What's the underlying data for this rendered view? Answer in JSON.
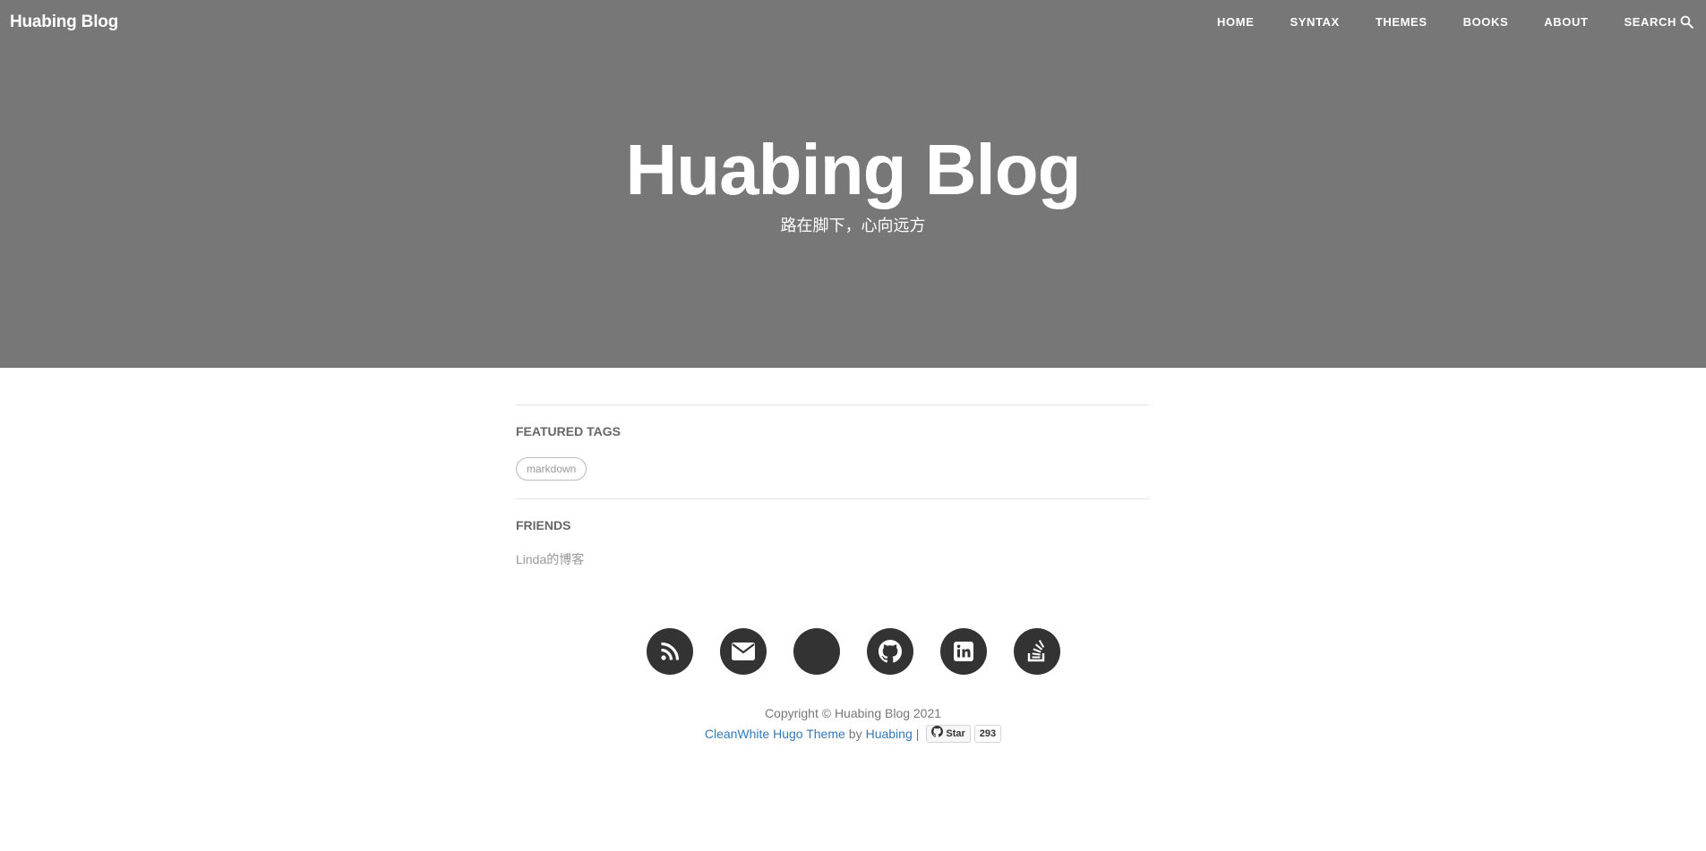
{
  "brand": "Huabing Blog",
  "nav": {
    "items": [
      "HOME",
      "SYNTAX",
      "THEMES",
      "BOOKS",
      "ABOUT"
    ],
    "search_label": "SEARCH",
    "search_icon": "search-icon"
  },
  "hero": {
    "title": "Huabing Blog",
    "subtitle": "路在脚下，心向远方"
  },
  "featured_tags": {
    "heading": "FEATURED TAGS",
    "tags": [
      "markdown"
    ]
  },
  "friends": {
    "heading": "FRIENDS",
    "links": [
      "Linda的博客"
    ]
  },
  "social": {
    "icons": [
      "rss-icon",
      "envelope-icon",
      "blank-social-icon",
      "github-icon",
      "linkedin-icon",
      "stackoverflow-icon"
    ]
  },
  "footer": {
    "copyright": "Copyright © Huabing Blog 2021",
    "theme_link": "CleanWhite Hugo Theme",
    "by": "by",
    "author_link": "Huabing",
    "separator": "|",
    "star_label": "Star",
    "star_count": "293"
  },
  "colors": {
    "hero_bg": "#777777",
    "link": "#337ab7",
    "social_bg": "#333333"
  }
}
